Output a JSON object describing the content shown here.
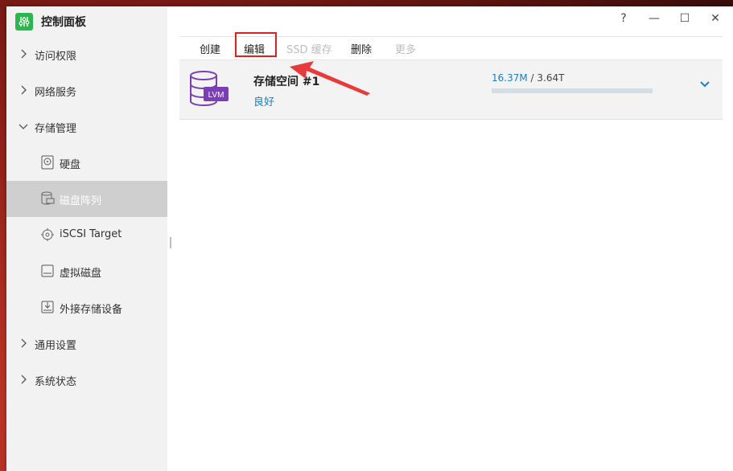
{
  "app": {
    "title": "控制面板",
    "icon": "control-panel-sliders-icon",
    "accent": "#2cb64e"
  },
  "window_controls": {
    "help": "?",
    "minimize": "—",
    "maximize": "☐",
    "close": "✕"
  },
  "sidebar": {
    "items": [
      {
        "label": "访问权限",
        "type": "group",
        "expanded": false
      },
      {
        "label": "网络服务",
        "type": "group",
        "expanded": false
      },
      {
        "label": "存储管理",
        "type": "group",
        "expanded": true
      },
      {
        "label": "硬盘",
        "type": "sub",
        "icon": "hard-disk-icon"
      },
      {
        "label": "磁盘阵列",
        "type": "sub",
        "icon": "raid-array-icon",
        "active": true
      },
      {
        "label": "iSCSI Target",
        "type": "sub",
        "icon": "iscsi-icon"
      },
      {
        "label": "虚拟磁盘",
        "type": "sub",
        "icon": "virtual-disk-icon"
      },
      {
        "label": "外接存储设备",
        "type": "sub",
        "icon": "external-storage-icon"
      },
      {
        "label": "通用设置",
        "type": "group",
        "expanded": false
      },
      {
        "label": "系统状态",
        "type": "group",
        "expanded": false
      }
    ]
  },
  "toolbar": {
    "create": "创建",
    "edit": "编辑",
    "ssd_cache": "SSD 缓存",
    "delete": "删除",
    "more": "更多"
  },
  "storage_pool": {
    "icon_label": "LVM",
    "name": "存储空间 #1",
    "status": "良好",
    "used": "16.37M",
    "separator": " / ",
    "total": "3.64T",
    "usage_fraction": 0.0,
    "colors": {
      "status": "#1a7fc4",
      "icon": "#7b3fb5"
    }
  }
}
